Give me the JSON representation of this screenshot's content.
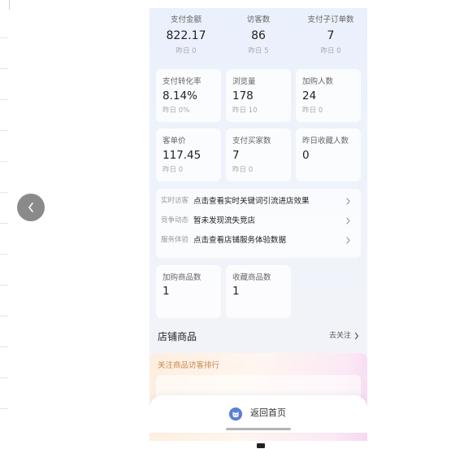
{
  "summary": [
    {
      "label": "支付金额",
      "value": "822.17",
      "prev": "昨日 0"
    },
    {
      "label": "访客数",
      "value": "86",
      "prev": "昨日 5"
    },
    {
      "label": "支付子订单数",
      "value": "7",
      "prev": "昨日 0"
    }
  ],
  "cards": [
    {
      "label": "支付转化率",
      "value": "8.14%",
      "prev": "昨日 0%"
    },
    {
      "label": "浏览量",
      "value": "178",
      "prev": "昨日 10"
    },
    {
      "label": "加购人数",
      "value": "24",
      "prev": "昨日 0"
    },
    {
      "label": "客单价",
      "value": "117.45",
      "prev": "昨日 0"
    },
    {
      "label": "支付买家数",
      "value": "7",
      "prev": "昨日 0"
    },
    {
      "label": "昨日收藏人数",
      "value": "0",
      "prev": ""
    }
  ],
  "info": [
    {
      "tag": "实时访客",
      "text": "点击查看实时关键词引流进店效果"
    },
    {
      "tag": "竞争动态",
      "text": "暂未发现流失竞店"
    },
    {
      "tag": "服务体验",
      "text": "点击查看店铺服务体验数据"
    }
  ],
  "cards2": [
    {
      "label": "加购商品数",
      "value": "1"
    },
    {
      "label": "收藏商品数",
      "value": "1"
    }
  ],
  "store": {
    "title": "店铺商品",
    "link": "去关注"
  },
  "rank": {
    "title": "关注商品访客排行"
  },
  "return_bar": {
    "label": "返回首页"
  },
  "icons": {
    "prev": "chevron-left-icon",
    "row_arrow": "chevron-right-icon",
    "link_arrow": "chevron-right-icon",
    "home": "cat-logo-icon"
  },
  "colors": {
    "rank_title": "#c9874a",
    "return_icon": "#5b7fd6",
    "prev_button": "#8a8a8a"
  }
}
